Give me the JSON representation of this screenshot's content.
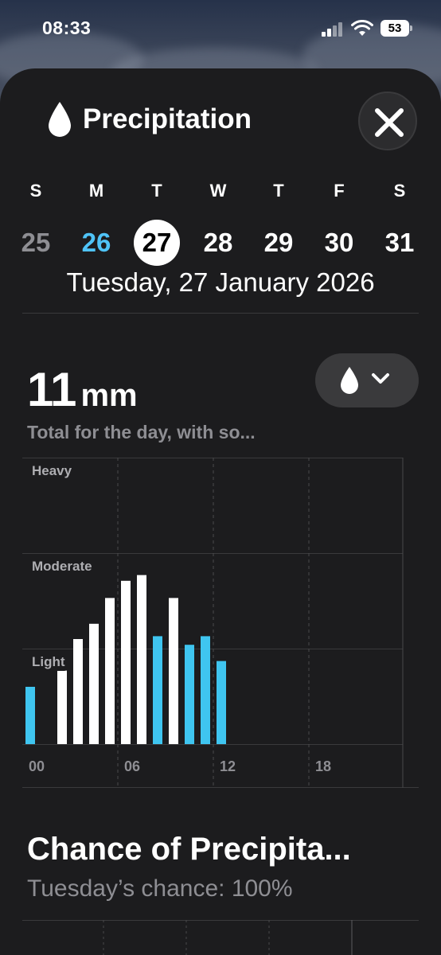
{
  "status_bar": {
    "time": "08:33",
    "battery": "53"
  },
  "header": {
    "title": "Precipitation"
  },
  "week": {
    "days": [
      {
        "dow": "S",
        "num": "25",
        "state": "past"
      },
      {
        "dow": "M",
        "num": "26",
        "state": "today"
      },
      {
        "dow": "T",
        "num": "27",
        "state": "selected"
      },
      {
        "dow": "W",
        "num": "28",
        "state": "future"
      },
      {
        "dow": "T",
        "num": "29",
        "state": "future"
      },
      {
        "dow": "F",
        "num": "30",
        "state": "future"
      },
      {
        "dow": "S",
        "num": "31",
        "state": "future"
      }
    ],
    "selected_date": "Tuesday, 27 January 2026"
  },
  "summary": {
    "amount": "11",
    "unit": "mm",
    "subtitle": "Total for the day, with so..."
  },
  "chart_data": {
    "type": "bar",
    "x_ticks": [
      "00",
      "06",
      "12",
      "18"
    ],
    "y_levels": [
      "Light",
      "Moderate",
      "Heavy"
    ],
    "ylim": [
      0,
      3
    ],
    "hours": [
      0,
      1,
      2,
      3,
      4,
      5,
      6,
      7,
      8,
      9,
      10,
      11,
      12
    ],
    "values": [
      0.6,
      0,
      0.77,
      1.1,
      1.26,
      1.53,
      1.71,
      1.77,
      1.13,
      1.53,
      1.04,
      1.13,
      0.87
    ],
    "kinds": [
      "rain",
      "none",
      "snow",
      "snow",
      "snow",
      "snow",
      "snow",
      "snow",
      "rain",
      "snow",
      "rain",
      "rain",
      "rain"
    ],
    "colors": {
      "rain": "#3fc5f0",
      "snow": "#ffffff"
    }
  },
  "chance": {
    "title": "Chance of Precipita...",
    "subtitle": "Tuesday’s chance: 100%"
  }
}
